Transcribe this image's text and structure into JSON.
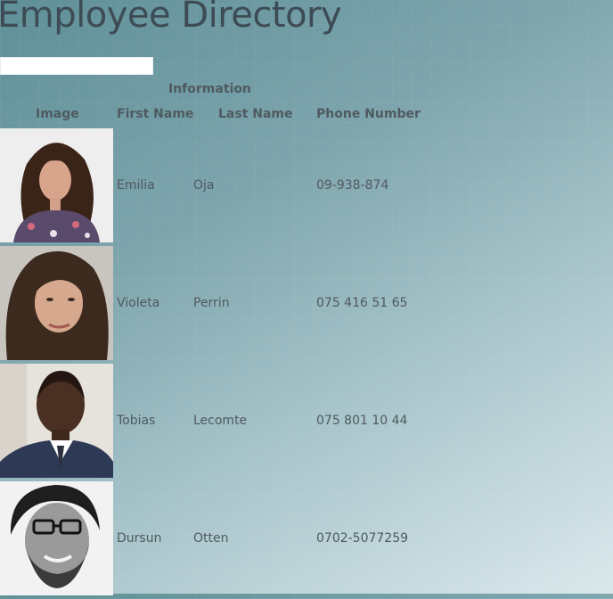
{
  "page": {
    "title": "Employee Directory"
  },
  "search": {
    "value": "",
    "placeholder": ""
  },
  "table": {
    "group_header": "Information",
    "columns": {
      "image": "Image",
      "first_name": "First Name",
      "last_name": "Last Name",
      "phone": "Phone Number"
    },
    "rows": [
      {
        "first_name": "Emilia",
        "last_name": "Oja",
        "phone": "09-938-874",
        "photo_icon": "woman-curly-hair-portrait"
      },
      {
        "first_name": "Violeta",
        "last_name": "Perrin",
        "phone": "075 416 51 65",
        "photo_icon": "woman-dark-hair-portrait"
      },
      {
        "first_name": "Tobias",
        "last_name": "Lecomte",
        "phone": "075 801 10 44",
        "photo_icon": "man-suit-portrait"
      },
      {
        "first_name": "Dursun",
        "last_name": "Otten",
        "phone": "0702-5077259",
        "photo_icon": "man-glasses-bw-portrait"
      }
    ]
  }
}
